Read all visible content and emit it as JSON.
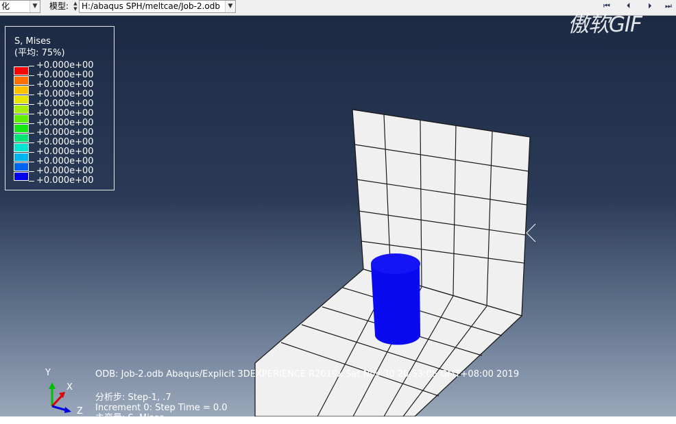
{
  "toolbar": {
    "left_combo_value": "化",
    "model_label": "模型:",
    "model_path": "H:/abaqus SPH/meltcae/Job-2.odb",
    "anim_first": "⏮",
    "anim_prev": "⏴",
    "anim_next": "⏵",
    "anim_last": "⏭"
  },
  "legend": {
    "title": "S, Mises",
    "subtitle": "(平均: 75%)",
    "colors": [
      "#ff0000",
      "#ff7000",
      "#ffc000",
      "#e6e600",
      "#a6f000",
      "#5cf000",
      "#14e614",
      "#00e676",
      "#00e6d2",
      "#00b4f0",
      "#0064f0",
      "#0000f5"
    ],
    "values": [
      "+0.000e+00",
      "+0.000e+00",
      "+0.000e+00",
      "+0.000e+00",
      "+0.000e+00",
      "+0.000e+00",
      "+0.000e+00",
      "+0.000e+00",
      "+0.000e+00",
      "+0.000e+00",
      "+0.000e+00",
      "+0.000e+00",
      "+0.000e+00"
    ]
  },
  "watermark": "傲软GIF",
  "info": {
    "odb_line": "ODB: Job-2.odb    Abaqus/Explicit 3DEXPERIENCE R2019x    Sat Nov 30 20:53:05 GMT+08:00 2019",
    "step_line": "分析步: Step-1, .7",
    "increment_line": "Increment         0: Step Time = 0.0",
    "var_line": "主变量: S, Mises"
  },
  "triad": {
    "y": "Y",
    "x": "X",
    "z": "Z"
  },
  "colors": {
    "mesh_fill": "#f0f0f0",
    "mesh_line": "#1a1a1a",
    "cylinder": "#0a0af0",
    "cylinder_top": "#1414f5"
  }
}
